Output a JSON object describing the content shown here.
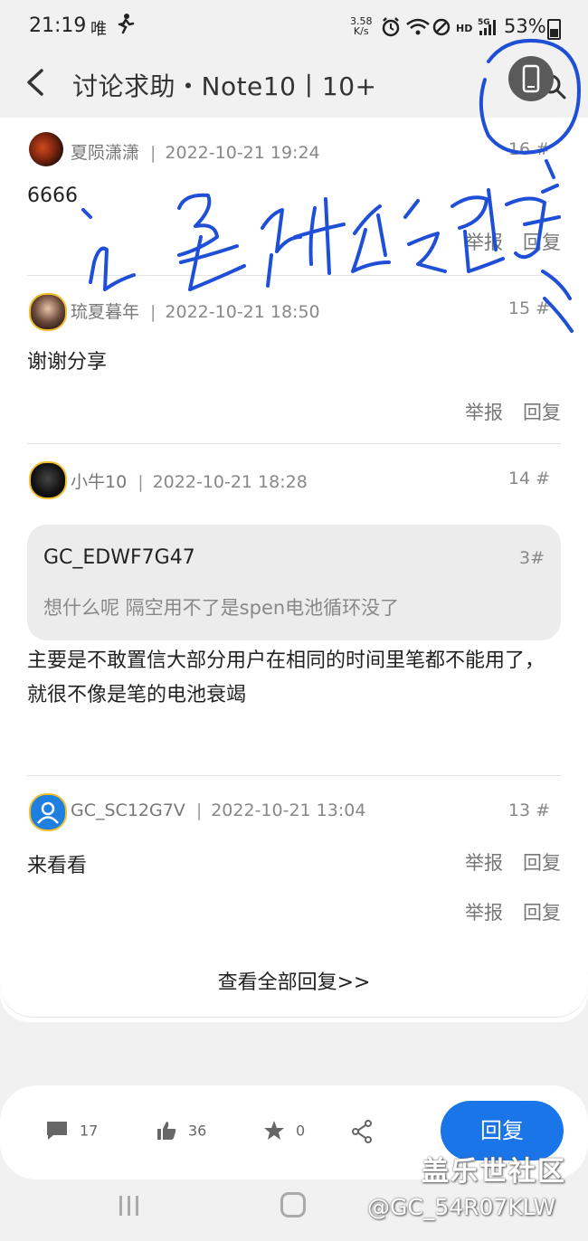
{
  "status_bar": {
    "time": "21:19",
    "carrier": "唯",
    "net_speed_value": "3.58",
    "net_speed_unit": "K/s",
    "hd": "HD",
    "signal": "5G",
    "battery": "53%"
  },
  "header": {
    "title": "讨论求助・Note10丨10+"
  },
  "replies": [
    {
      "user": "夏陨潇潇",
      "date": "2022-10-21 19:24",
      "floor": "16 #",
      "body": "6666",
      "report": "举报",
      "reply": "回复"
    },
    {
      "user": "琉夏暮年",
      "date": "2022-10-21 18:50",
      "floor": "15 #",
      "body": "谢谢分享",
      "report": "举报",
      "reply": "回复"
    },
    {
      "user": "小牛10",
      "date": "2022-10-21 18:28",
      "floor": "14 #",
      "quote": {
        "user": "GC_EDWF7G47",
        "floor": "3#",
        "text": "想什么呢  隔空用不了是spen电池循环没了"
      },
      "body": "主要是不敢置信大部分用户在相同的时间里笔都不能用了，就很不像是笔的电池衰竭",
      "report": "举报",
      "reply": "回复"
    },
    {
      "user": "GC_SC12G7V",
      "date": "2022-10-21 13:04",
      "floor": "13 #",
      "body": "来看看",
      "report": "举报",
      "reply": "回复"
    }
  ],
  "view_all": "查看全部回复>>",
  "bottom_bar": {
    "comments": "17",
    "likes": "36",
    "favorites": "0",
    "reply_button": "回复"
  },
  "watermark": {
    "line1": "盖乐世社区",
    "line2": "@GC_54R07KLW"
  },
  "colors": {
    "accent": "#1a75e8",
    "background": "#f1f1f1",
    "card": "#ffffff",
    "ink": "#1f4fd6"
  }
}
